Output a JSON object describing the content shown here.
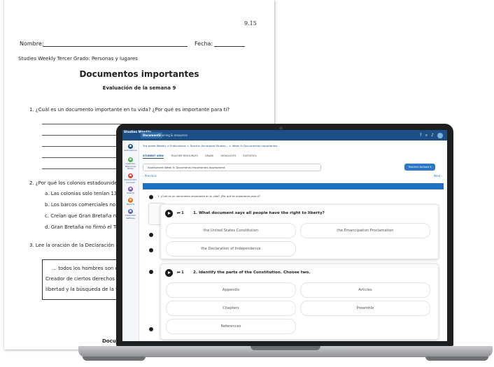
{
  "worksheet": {
    "page_number": "9.15",
    "name_label": "Nombre:",
    "date_label": "Fecha:",
    "course": "Studies Weekly Tercer Grado: Personas y lugares",
    "title": "Documentos importantes",
    "subtitle": "Evaluación de la semana 9",
    "q1": "1.  ¿Cuál es un documento importante en tu vida? ¿Por qué es importante para ti?",
    "q2": "2.  ¿Por qué los colonos estadounide",
    "q2_options": [
      "a.  Las colonias solo tenían 13",
      "b.  Los barcos comerciales no",
      "c.  Creían que Gran Bretaña n",
      "d.  Gran Bretaña no firmó el Tr"
    ],
    "q3": "3.  Lee la oración de la Declaración",
    "quote_lines": [
      "… todos los hombres son crec",
      "Creador de ciertos derechos ina",
      "libertad y la búsqueda de la felic"
    ],
    "footer": "Docume"
  },
  "app": {
    "logo": "Studies Weekly",
    "tabs": [
      "Documents",
      "Training & resources"
    ],
    "sidebar": [
      "Publications",
      "Calendar Resources Notes",
      "Assessment Connect",
      "Awards",
      "Reports",
      "Classroom Settings"
    ],
    "breadcrumb": "3rd grade Weekly  >  Publications  >  Teacher Annotated Studies...  >  Week 9: Documentos importantes",
    "subtabs": [
      "STUDENT VIEW",
      "TEACHER RESOURCES",
      "GRADE",
      "HIGHLIGHTS",
      "STATISTICS"
    ],
    "assessment_select": "Assessment Week 9: Documents Importantes Assessment",
    "teacher_actions": "Teacher Actions ▾",
    "previous": "‹ Previous",
    "next": "Next ›",
    "bg_question": "1. ¿Cuál es un documento importante en tu vida? ¿Por qué es importante para ti?",
    "card1": {
      "number_question": "1. What document says all people have the right to liberty?",
      "options": [
        "the United States Constitution",
        "the Emancipation Proclamation",
        "the Declaration of Independence"
      ]
    },
    "card2": {
      "number_question": "2. Identify the parts of the Constitution. Choose two.",
      "options": [
        "Appendix",
        "Articles",
        "Chapters",
        "Preamble",
        "References"
      ]
    },
    "controls": "⏮ 1"
  },
  "colors": {
    "brand_blue": "#1c4f86",
    "accent_blue": "#1f6fc2"
  }
}
